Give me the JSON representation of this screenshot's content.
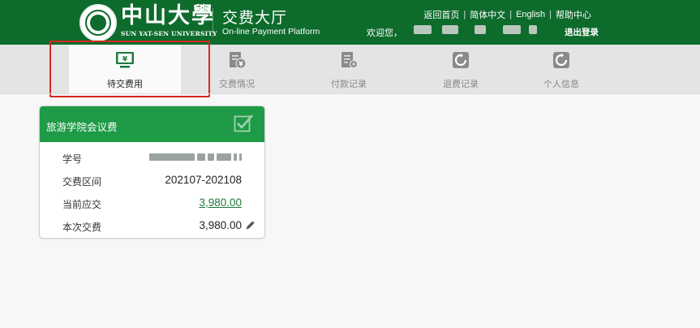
{
  "header": {
    "logo_cn": "中山大學",
    "logo_en": "SUN YAT-SEN UNIVERSITY",
    "system_title": "交费大厅",
    "system_subtitle": "On-line Payment Platform",
    "links": {
      "home": "返回首页",
      "lang_cn": "简体中文",
      "lang_en": "English",
      "help": "帮助中心"
    },
    "welcome": "欢迎您，",
    "logout": "退出登录"
  },
  "nav": {
    "items": [
      {
        "label": "待交费用",
        "icon": "monitor-yen-icon"
      },
      {
        "label": "交费情况",
        "icon": "document-yen-icon"
      },
      {
        "label": "付款记录",
        "icon": "document-gear-icon"
      },
      {
        "label": "退费记录",
        "icon": "refund-icon"
      },
      {
        "label": "个人信息",
        "icon": "refresh-user-icon"
      }
    ],
    "active_index": 0
  },
  "card": {
    "title": "旅游学院会议费",
    "rows": [
      {
        "key": "学号",
        "value": ""
      },
      {
        "key": "交费区间",
        "value": "202107-202108"
      },
      {
        "key": "当前应交",
        "value": "3,980.00"
      },
      {
        "key": "本次交费",
        "value": "3,980.00"
      }
    ]
  },
  "colors": {
    "header_green": "#0d6b2c",
    "card_green": "#1f9a47",
    "highlight_red": "#d9271f"
  }
}
